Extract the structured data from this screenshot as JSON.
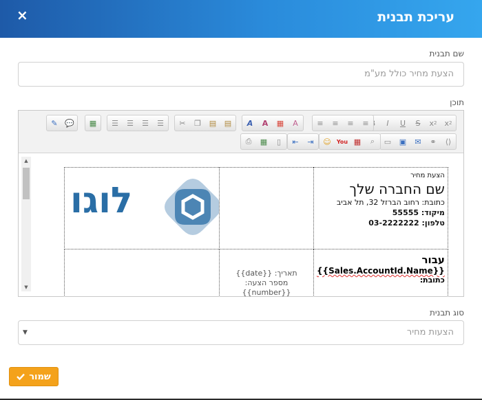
{
  "dialog": {
    "title": "עריכת תבנית",
    "close_icon": "×"
  },
  "template_name": {
    "label": "שם תבנית",
    "value": "הצעת מחיר כולל מע\"מ"
  },
  "content": {
    "label": "תוכן"
  },
  "template_body": {
    "quote_label": "הצעת מחיר",
    "company_name": "שם החברה שלך",
    "address_line": "כתובת: רחוב הברזל 32, תל אביב",
    "zip_line": "מיקוד: 55555",
    "phone_line": "טלפון: 03-2222222",
    "logo_text": "לוגו",
    "for_label": "עבור",
    "account_field": "{{Sales.AccountId.Name}}",
    "address_label": "כתובת:",
    "date_line": "תאריך: {{date}}",
    "quote_number_label": "מספר הצעה:",
    "quote_number_field": "{{number}}"
  },
  "template_type": {
    "label": "סוג תבנית",
    "value": "הצעות מחיר"
  },
  "save_button": {
    "label": "שמור"
  },
  "colors": {
    "header_start": "#1e5aa8",
    "header_end": "#35a6ee",
    "accent": "#f4a21b",
    "logo": "#2a6ea6"
  }
}
